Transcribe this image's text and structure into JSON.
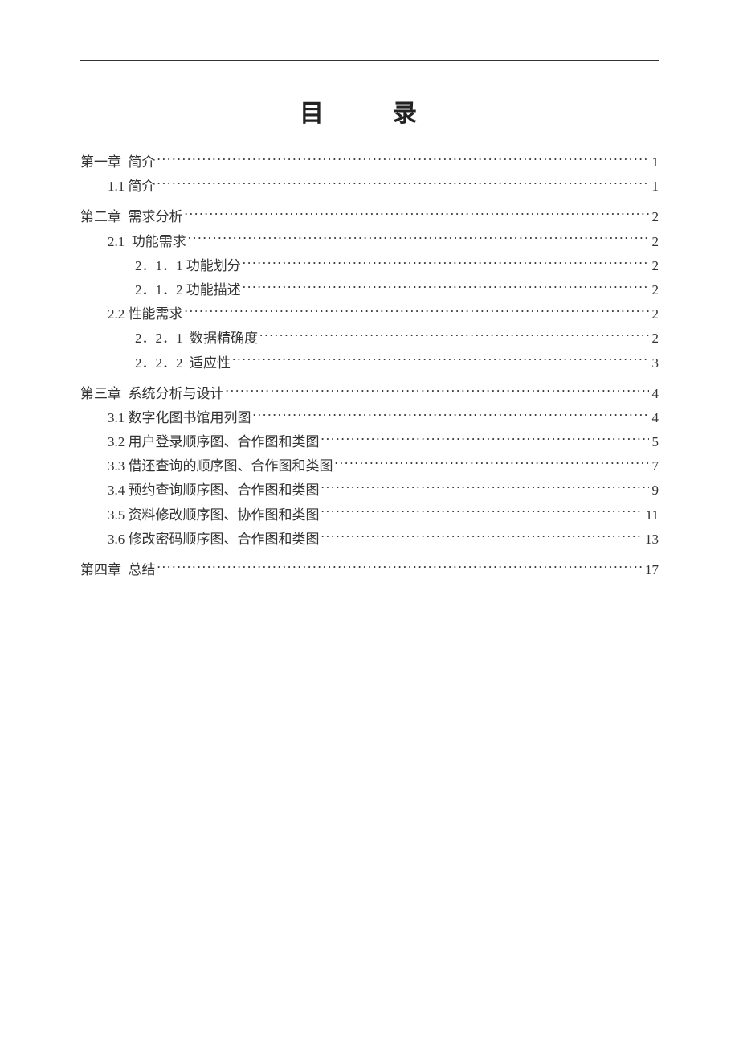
{
  "title": "目　录",
  "toc": [
    {
      "level": 1,
      "label": "第一章  简介",
      "page": "1",
      "gapBefore": false
    },
    {
      "level": 2,
      "label": "1.1 简介",
      "page": "1",
      "gapBefore": false
    },
    {
      "level": 1,
      "label": "第二章  需求分析",
      "page": "2",
      "gapBefore": true
    },
    {
      "level": 2,
      "label": "2.1  功能需求",
      "page": "2",
      "gapBefore": false
    },
    {
      "level": 3,
      "label": "2．1．1 功能划分",
      "page": "2",
      "gapBefore": false
    },
    {
      "level": 3,
      "label": "2．1．2 功能描述",
      "page": "2",
      "gapBefore": false
    },
    {
      "level": 2,
      "label": "2.2 性能需求",
      "page": "2",
      "gapBefore": false
    },
    {
      "level": 3,
      "label": "2．2．1  数据精确度",
      "page": "2",
      "gapBefore": false
    },
    {
      "level": 3,
      "label": "2．2．2  适应性",
      "page": "3",
      "gapBefore": false
    },
    {
      "level": 1,
      "label": "第三章  系统分析与设计",
      "page": "4",
      "gapBefore": true
    },
    {
      "level": 2,
      "label": "3.1 数字化图书馆用列图",
      "page": "4",
      "gapBefore": false
    },
    {
      "level": 2,
      "label": "3.2 用户登录顺序图、合作图和类图",
      "page": "5",
      "gapBefore": false
    },
    {
      "level": 2,
      "label": "3.3 借还查询的顺序图、合作图和类图",
      "page": "7",
      "gapBefore": false
    },
    {
      "level": 2,
      "label": "3.4 预约查询顺序图、合作图和类图",
      "page": "9",
      "gapBefore": false
    },
    {
      "level": 2,
      "label": "3.5 资料修改顺序图、协作图和类图",
      "page": "11",
      "gapBefore": false
    },
    {
      "level": 2,
      "label": "3.6 修改密码顺序图、合作图和类图",
      "page": "13",
      "gapBefore": false
    },
    {
      "level": 1,
      "label": "第四章  总结",
      "page": "17",
      "gapBefore": true
    }
  ]
}
